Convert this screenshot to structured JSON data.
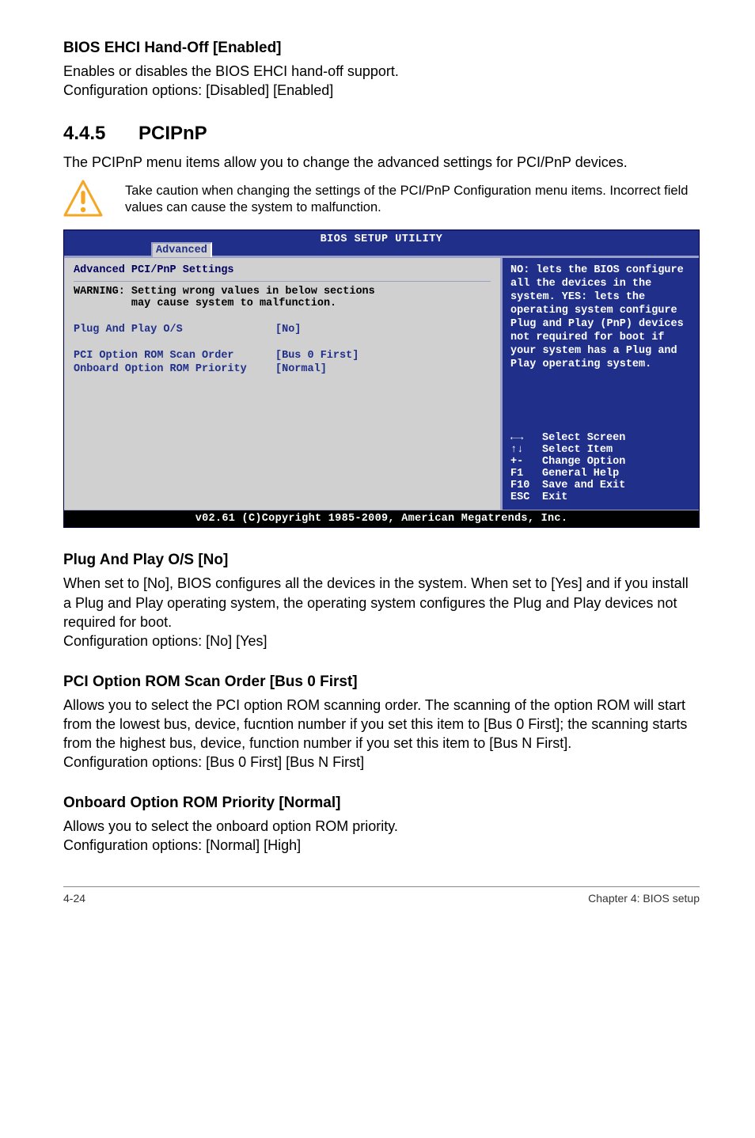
{
  "h_bios_ehci": "BIOS EHCI Hand-Off [Enabled]",
  "p_bios_ehci_1": "Enables or disables the BIOS EHCI hand-off support.",
  "p_bios_ehci_2": "Configuration options: [Disabled] [Enabled]",
  "sec_num": "4.4.5",
  "sec_title": "PCIPnP",
  "p_pcipnp": "The PCIPnP menu items allow you to change the advanced settings for PCI/PnP devices.",
  "caution": "Take caution when changing the settings of the PCI/PnP Configuration menu items. Incorrect field values can cause the system to malfunction.",
  "bios": {
    "title": "BIOS SETUP UTILITY",
    "tab": "Advanced",
    "left_heading": "Advanced PCI/PnP Settings",
    "warning_l1": "WARNING: Setting wrong values in below sections",
    "warning_l2": "         may cause system to malfunction.",
    "entries": [
      {
        "label": "Plug And Play O/S",
        "value": "[No]"
      },
      {
        "label": "PCI Option ROM Scan Order",
        "value": "[Bus 0 First]"
      },
      {
        "label": "Onboard Option ROM Priority",
        "value": "[Normal]"
      }
    ],
    "help": "NO: lets the BIOS configure all the devices in the system. YES: lets the operating system configure Plug and Play (PnP) devices not required for boot if your system has a Plug and Play operating system.",
    "nav": [
      {
        "key": "←→",
        "label": "Select Screen"
      },
      {
        "key": "↑↓",
        "label": "Select Item"
      },
      {
        "key": "+-",
        "label": "Change Option"
      },
      {
        "key": "F1",
        "label": "General Help"
      },
      {
        "key": "F10",
        "label": "Save and Exit"
      },
      {
        "key": "ESC",
        "label": "Exit"
      }
    ],
    "footer": "v02.61 (C)Copyright 1985-2009, American Megatrends, Inc."
  },
  "h_plug": "Plug And Play O/S [No]",
  "p_plug_1": "When set to [No], BIOS configures all the devices in the system. When set to [Yes] and if you install a Plug and Play operating system, the operating system configures the Plug and Play devices not required for boot.",
  "p_plug_2": "Configuration options: [No] [Yes]",
  "h_scan": "PCI Option ROM Scan Order [Bus 0 First]",
  "p_scan_1": "Allows you to select the PCI option ROM scanning order. The scanning of the option ROM will start from the lowest bus, device, fucntion number if you set this item to [Bus 0 First]; the scanning starts from the highest bus, device, function number if you set this item to [Bus N First].",
  "p_scan_2": "Configuration options: [Bus 0 First] [Bus N First]",
  "h_onboard": "Onboard Option ROM Priority [Normal]",
  "p_onboard_1": "Allows you to select the onboard option ROM priority.",
  "p_onboard_2": "Configuration options: [Normal] [High]",
  "footer_left": "4-24",
  "footer_right": "Chapter 4: BIOS setup"
}
